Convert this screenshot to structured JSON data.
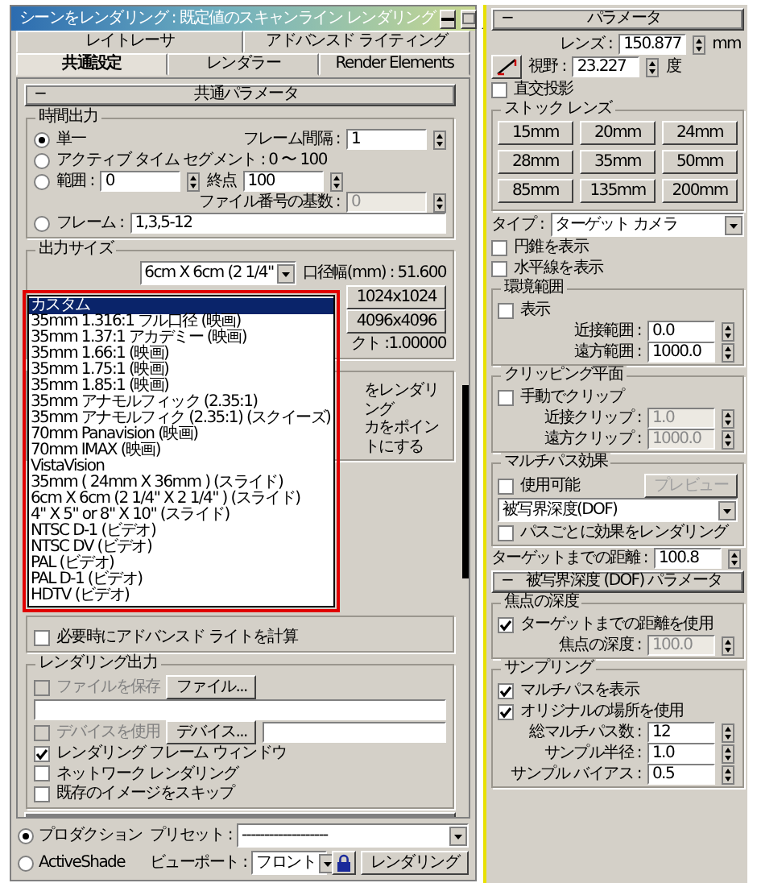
{
  "window": {
    "title": "シーンをレンダリング : 既定値のスキャンライン レンダリング"
  },
  "tabs_back": [
    {
      "label": "レイトレーサ",
      "selected": false
    },
    {
      "label": "アドバンスド ライティング",
      "selected": false
    }
  ],
  "tabs_front": [
    {
      "label": "共通設定",
      "selected": true
    },
    {
      "label": "レンダラー",
      "selected": false
    },
    {
      "label": "Render Elements",
      "selected": false
    }
  ],
  "left_panel": [
    {
      "kind": "rollout",
      "sign": "−",
      "title": "共通パラメータ"
    },
    {
      "kind": "group",
      "title": "時間出力",
      "lines": [
        {
          "items": [
            {
              "kind": "radio",
              "label": "単一",
              "selected": true
            },
            {
              "kind": "spinner",
              "label": "フレーム間隔 :",
              "value": "1"
            }
          ]
        },
        {
          "items": [
            {
              "kind": "radio",
              "label": "アクティブ タイム セグメント : 0 〜 100",
              "selected": false
            }
          ]
        },
        {
          "items": [
            {
              "kind": "radio",
              "label": "範囲 :",
              "selected": false
            },
            {
              "kind": "spinner",
              "value": "0"
            },
            {
              "kind": "spinner",
              "label": "終点",
              "value": "100"
            }
          ]
        },
        {
          "items": [
            {
              "kind": "spinner",
              "label": "ファイル番号の基数 :",
              "value": "0",
              "disabled": true
            }
          ]
        },
        {
          "items": [
            {
              "kind": "radio",
              "label": "フレーム :",
              "selected": false
            },
            {
              "kind": "field",
              "value": "1,3,5-12"
            }
          ]
        }
      ]
    },
    {
      "kind": "group",
      "title": "出力サイズ",
      "lines": [
        {
          "items": [
            {
              "kind": "dropdown",
              "value": "6cm X 6cm (2 1/4\""
            },
            {
              "kind": "text",
              "text": "口径幅(mm) : 51.600"
            }
          ]
        },
        {
          "items": [
            {
              "kind": "button",
              "label": "1024x1024"
            }
          ]
        },
        {
          "items": [
            {
              "kind": "button",
              "label": "4096x4096"
            }
          ]
        },
        {
          "items": [
            {
              "kind": "text",
              "text": "クト :1.00000"
            }
          ]
        }
      ],
      "list": [
        {
          "label": "カスタム",
          "selected": true
        },
        {
          "label": "35mm 1.316:1 フル口径 (映画)",
          "selected": false
        },
        {
          "label": "35mm 1.37:1 アカデミー (映画)",
          "selected": false
        },
        {
          "label": "35mm 1.66:1 (映画)",
          "selected": false
        },
        {
          "label": "35mm 1.75:1 (映画)",
          "selected": false
        },
        {
          "label": "35mm 1.85:1 (映画)",
          "selected": false
        },
        {
          "label": "35mm アナモルフィック (2.35:1)",
          "selected": false
        },
        {
          "label": "35mm アナモルフィク (2.35:1) (スクイーズ)",
          "selected": false
        },
        {
          "label": "70mm Panavision (映画)",
          "selected": false
        },
        {
          "label": "70mm IMAX (映画)",
          "selected": false
        },
        {
          "label": "VistaVision",
          "selected": false
        },
        {
          "label": "35mm ( 24mm X 36mm ) (スライド)",
          "selected": false
        },
        {
          "label": "6cm X 6cm (2 1/4\" X 2 1/4\" ) (スライド)",
          "selected": false
        },
        {
          "label": "4\" X 5\" or 8\" X 10\" (スライド)",
          "selected": false
        },
        {
          "label": "NTSC D-1 (ビデオ)",
          "selected": false
        },
        {
          "label": "NTSC DV (ビデオ)",
          "selected": false
        },
        {
          "label": "PAL (ビデオ)",
          "selected": false
        },
        {
          "label": "PAL D-1 (ビデオ)",
          "selected": false
        },
        {
          "label": "HDTV (ビデオ)",
          "selected": false
        }
      ]
    },
    {
      "kind": "group",
      "lines": [
        {
          "items": [
            {
              "kind": "text",
              "text": "をレンダリング"
            }
          ]
        },
        {
          "items": [
            {
              "kind": "text",
              "text": "カをポイントにする"
            }
          ]
        }
      ]
    },
    {
      "kind": "group",
      "lines": [
        {
          "items": [
            {
              "kind": "checkbox",
              "label": "必要時にアドバンスド ライトを計算",
              "checked": false
            }
          ]
        }
      ]
    },
    {
      "kind": "group",
      "title": "レンダリング出力",
      "lines": [
        {
          "items": [
            {
              "kind": "checkbox",
              "label": "ファイルを保存",
              "checked": false,
              "disabled": true
            },
            {
              "kind": "button",
              "label": "ファイル..."
            }
          ]
        },
        {
          "items": [
            {
              "kind": "field"
            }
          ]
        },
        {
          "items": [
            {
              "kind": "checkbox",
              "label": "デバイスを使用",
              "checked": false,
              "disabled": true
            },
            {
              "kind": "button",
              "label": "デバイス..."
            },
            {
              "kind": "field"
            }
          ]
        },
        {
          "items": [
            {
              "kind": "checkbox",
              "label": "レンダリング フレーム ウィンドウ",
              "checked": true
            },
            {
              "kind": "checkbox",
              "label": "ネットワーク レンダリング",
              "checked": false
            }
          ]
        },
        {
          "items": [
            {
              "kind": "checkbox",
              "label": "既存のイメージをスキップ",
              "checked": false
            }
          ]
        }
      ]
    },
    {
      "kind": "rollout"
    }
  ],
  "bottom": [
    {
      "items": [
        {
          "kind": "radio",
          "label": "プロダクション",
          "selected": true
        },
        {
          "kind": "text",
          "text": "プリセット :"
        },
        {
          "kind": "dropdown",
          "value": "-------------------"
        }
      ]
    },
    {
      "items": [
        {
          "kind": "radio",
          "label": "ActiveShade",
          "selected": false
        },
        {
          "kind": "text",
          "text": "ビューポート :"
        },
        {
          "kind": "dropdown",
          "value": "フロント"
        },
        {
          "kind": "lock"
        },
        {
          "kind": "button",
          "label": "レンダリング"
        }
      ]
    }
  ],
  "right_panel": [
    {
      "kind": "rollout",
      "sign": "−",
      "title": "パラメータ"
    },
    {
      "kind": "row",
      "items": [
        {
          "kind": "spinner",
          "label": "レンズ :",
          "value": "150.877",
          "unit": "mm"
        }
      ]
    },
    {
      "kind": "row",
      "items": [
        {
          "kind": "fov"
        },
        {
          "kind": "spinner",
          "label": "視野 :",
          "value": "23.227",
          "unit": "度"
        }
      ]
    },
    {
      "kind": "row",
      "items": [
        {
          "kind": "checkbox",
          "label": "直交投影",
          "checked": false
        }
      ]
    },
    {
      "kind": "group",
      "title": "ストック レンズ",
      "lines": [
        {
          "items": [
            {
              "kind": "button",
              "label": "15mm"
            },
            {
              "kind": "button",
              "label": "20mm"
            },
            {
              "kind": "button",
              "label": "24mm"
            }
          ]
        },
        {
          "items": [
            {
              "kind": "button",
              "label": "28mm"
            },
            {
              "kind": "button",
              "label": "35mm"
            },
            {
              "kind": "button",
              "label": "50mm"
            }
          ]
        },
        {
          "items": [
            {
              "kind": "button",
              "label": "85mm"
            },
            {
              "kind": "button",
              "label": "135mm"
            },
            {
              "kind": "button",
              "label": "200mm"
            }
          ]
        }
      ]
    },
    {
      "kind": "row",
      "items": [
        {
          "kind": "text",
          "text": "タイプ :"
        },
        {
          "kind": "dropdown",
          "value": "ターゲット カメラ"
        }
      ]
    },
    {
      "kind": "row",
      "items": [
        {
          "kind": "checkbox",
          "label": "円錐を表示",
          "checked": false
        }
      ]
    },
    {
      "kind": "row",
      "items": [
        {
          "kind": "checkbox",
          "label": "水平線を表示",
          "checked": false
        }
      ]
    },
    {
      "kind": "group",
      "title": "環境範囲",
      "lines": [
        {
          "items": [
            {
              "kind": "checkbox",
              "label": "表示",
              "checked": false
            }
          ]
        },
        {
          "items": [
            {
              "kind": "spinner",
              "label": "近接範囲 :",
              "value": "0.0"
            }
          ]
        },
        {
          "items": [
            {
              "kind": "spinner",
              "label": "遠方範囲 :",
              "value": "1000.0"
            }
          ]
        }
      ]
    },
    {
      "kind": "group",
      "title": "クリッピング平面",
      "lines": [
        {
          "items": [
            {
              "kind": "checkbox",
              "label": "手動でクリップ",
              "checked": false
            }
          ]
        },
        {
          "items": [
            {
              "kind": "spinner",
              "label": "近接クリップ :",
              "value": "1.0",
              "disabled": true
            }
          ]
        },
        {
          "items": [
            {
              "kind": "spinner",
              "label": "遠方クリップ :",
              "value": "1000.0",
              "disabled": true
            }
          ]
        }
      ]
    },
    {
      "kind": "group",
      "title": "マルチパス効果",
      "lines": [
        {
          "items": [
            {
              "kind": "checkbox",
              "label": "使用可能",
              "checked": false
            },
            {
              "kind": "button",
              "label": "プレビュー",
              "disabled": true
            }
          ]
        },
        {
          "items": [
            {
              "kind": "dropdown",
              "value": "被写界深度(DOF)"
            }
          ]
        },
        {
          "items": [
            {
              "kind": "checkbox",
              "label": "パスごとに効果をレンダリング",
              "checked": false
            }
          ]
        }
      ]
    },
    {
      "kind": "row",
      "items": [
        {
          "kind": "spinner",
          "label": "ターゲットまでの距離 :",
          "value": "100.8"
        }
      ]
    },
    {
      "kind": "rollout",
      "sign": "−",
      "title": "被写界深度 (DOF) パラメータ"
    },
    {
      "kind": "group",
      "title": "焦点の深度",
      "lines": [
        {
          "items": [
            {
              "kind": "checkbox",
              "label": "ターゲットまでの距離を使用",
              "checked": true
            }
          ]
        },
        {
          "items": [
            {
              "kind": "spinner",
              "label": "焦点の深度 :",
              "value": "100.0",
              "disabled": true
            }
          ]
        }
      ]
    },
    {
      "kind": "group",
      "title": "サンプリング",
      "lines": [
        {
          "items": [
            {
              "kind": "checkbox",
              "label": "マルチパスを表示",
              "checked": true
            }
          ]
        },
        {
          "items": [
            {
              "kind": "checkbox",
              "label": "オリジナルの場所を使用",
              "checked": true
            }
          ]
        },
        {
          "items": [
            {
              "kind": "spinner",
              "label": "総マルチパス数 :",
              "value": "12"
            }
          ]
        },
        {
          "items": [
            {
              "kind": "spinner",
              "label": "サンプル半径 :",
              "value": "1.0"
            }
          ]
        },
        {
          "items": [
            {
              "kind": "spinner",
              "label": "サンプル バイアス :",
              "value": "0.5"
            }
          ]
        }
      ]
    }
  ]
}
